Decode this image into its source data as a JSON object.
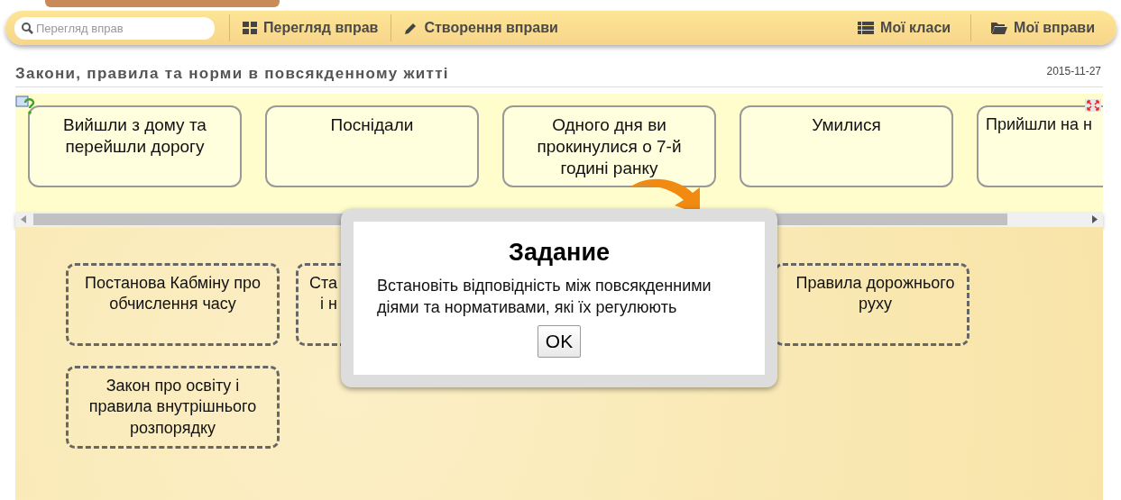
{
  "search": {
    "placeholder": "Перегляд вправ"
  },
  "nav_left": [
    {
      "label": "Перегляд вправ"
    },
    {
      "label": "Створення вправи"
    }
  ],
  "nav_right": [
    {
      "label": "Мої класи"
    },
    {
      "label": "Мої вправи"
    }
  ],
  "title": "Закони, правила та норми в повсякденному житті",
  "date": "2015-11-27",
  "source_cards": [
    {
      "text": "Вийшли з дому та перейшли дорогу"
    },
    {
      "text": "Поснідали"
    },
    {
      "text": "Одного дня ви прокинулися о 7-й годині ранку"
    },
    {
      "text": "Умилися"
    },
    {
      "text": "Прийшли на н"
    }
  ],
  "target_cards": [
    {
      "lines": [
        "Постанова Кабміну про",
        "обчислення часу"
      ]
    },
    {
      "lines": [
        "Ста",
        "і н"
      ]
    },
    {
      "lines": [
        "Правила дорожнього",
        "руху"
      ]
    },
    {
      "lines": [
        "Закон про освіту і",
        "правила внутрішнього",
        "розпорядку"
      ]
    }
  ],
  "dialog": {
    "title": "Задание",
    "message": "Встановіть відповідність між повсякденними діями та нормативами, які їх регулюють",
    "button": "OK"
  }
}
